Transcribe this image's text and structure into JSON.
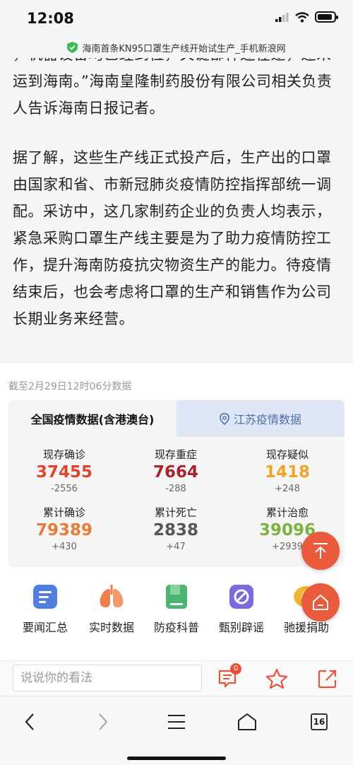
{
  "status_bar": {
    "time": "12:08"
  },
  "url_bar": {
    "title": "海南首条KN95口罩生产线开始试生产_手机新浪网"
  },
  "article": {
    "paragraphs": [
      "，机器设备均已经到位，关键部件还在途，还未运到海南。”海南皇隆制药股份有限公司相关负责人告诉海南日报记者。",
      "据了解，这些生产线正式投产后，生产出的口罩由国家和省、市新冠肺炎疫情防控指挥部统一调配。采访中，这几家制药企业的负责人均表示，紧急采购口罩生产线主要是为了助力疫情防控工作，提升海南防疫抗灾物资生产的能力。待疫情结束后，也会考虑将口罩的生产和销售作为公司长期业务来经营。"
    ]
  },
  "epidemic": {
    "as_of": "截至2月29日12时06分数据",
    "tabs": {
      "national": "全国疫情数据(含港澳台)",
      "jiangsu": "江苏疫情数据"
    },
    "stats": [
      {
        "label": "现存确诊",
        "value": "37455",
        "delta": "-2556",
        "color": "#e0442c"
      },
      {
        "label": "现存重症",
        "value": "7664",
        "delta": "-288",
        "color": "#a8232c"
      },
      {
        "label": "现存疑似",
        "value": "1418",
        "delta": "+248",
        "color": "#f0a42c"
      },
      {
        "label": "累计确诊",
        "value": "79389",
        "delta": "+430",
        "color": "#ea7b36"
      },
      {
        "label": "累计死亡",
        "value": "2838",
        "delta": "+47",
        "color": "#555555"
      },
      {
        "label": "累计治愈",
        "value": "39096",
        "delta": "+2939",
        "color": "#7ab33f"
      }
    ]
  },
  "shortcuts": [
    {
      "label": "要闻汇总",
      "icon": "news-summary-icon",
      "color": "#4f7de0"
    },
    {
      "label": "实时数据",
      "icon": "lungs-icon",
      "color": "#ee7c4c"
    },
    {
      "label": "防疫科普",
      "icon": "book-icon",
      "color": "#4cb370"
    },
    {
      "label": "甄别辟谣",
      "icon": "ban-icon",
      "color": "#7a6ae0"
    },
    {
      "label": "驰援捐助",
      "icon": "donation-icon",
      "color": "#f0b534"
    }
  ],
  "comment_bar": {
    "placeholder": "说说你的看法",
    "comment_count": "0"
  },
  "browser_nav": {
    "tab_count": "16"
  }
}
